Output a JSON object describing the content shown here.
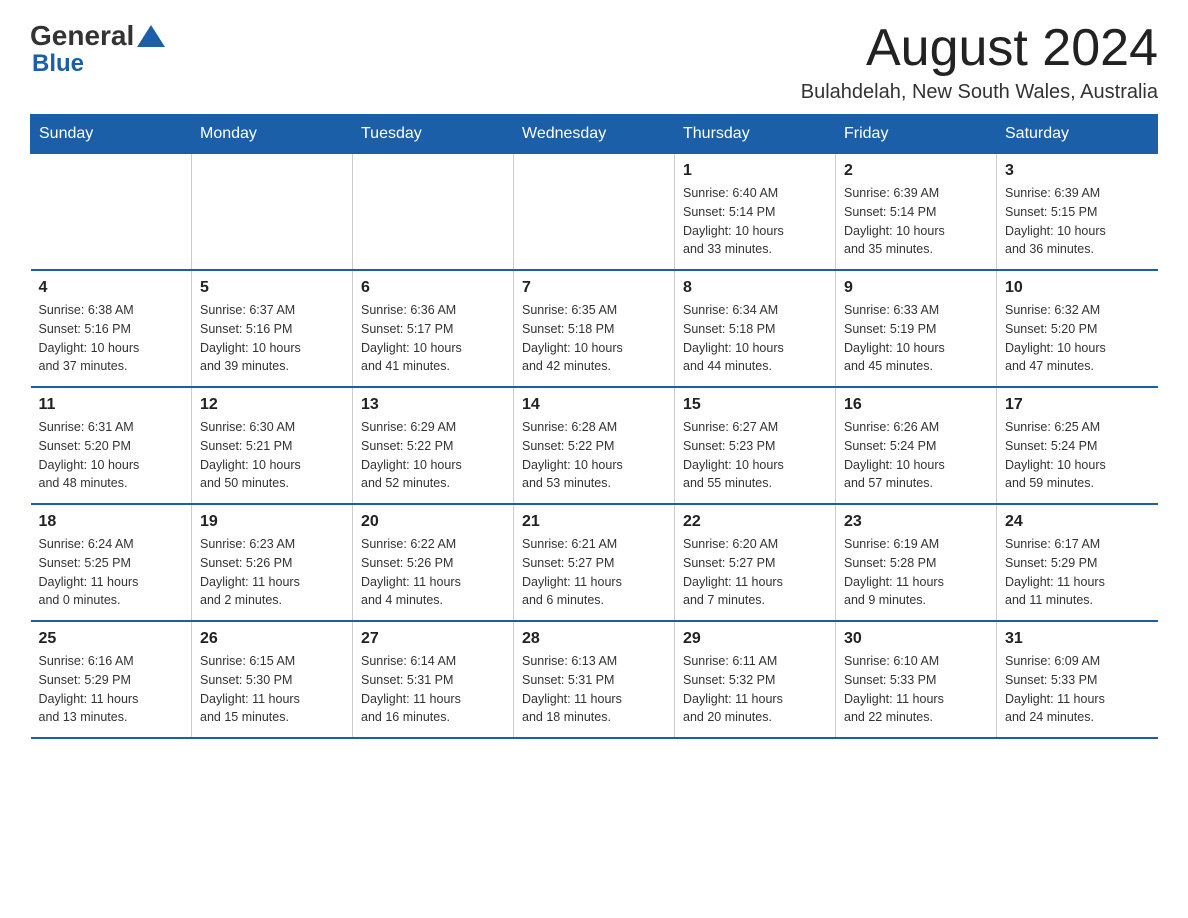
{
  "header": {
    "logo_general": "General",
    "logo_blue": "Blue",
    "month_title": "August 2024",
    "location": "Bulahdelah, New South Wales, Australia"
  },
  "calendar": {
    "days_of_week": [
      "Sunday",
      "Monday",
      "Tuesday",
      "Wednesday",
      "Thursday",
      "Friday",
      "Saturday"
    ],
    "weeks": [
      [
        {
          "day": "",
          "info": ""
        },
        {
          "day": "",
          "info": ""
        },
        {
          "day": "",
          "info": ""
        },
        {
          "day": "",
          "info": ""
        },
        {
          "day": "1",
          "info": "Sunrise: 6:40 AM\nSunset: 5:14 PM\nDaylight: 10 hours\nand 33 minutes."
        },
        {
          "day": "2",
          "info": "Sunrise: 6:39 AM\nSunset: 5:14 PM\nDaylight: 10 hours\nand 35 minutes."
        },
        {
          "day": "3",
          "info": "Sunrise: 6:39 AM\nSunset: 5:15 PM\nDaylight: 10 hours\nand 36 minutes."
        }
      ],
      [
        {
          "day": "4",
          "info": "Sunrise: 6:38 AM\nSunset: 5:16 PM\nDaylight: 10 hours\nand 37 minutes."
        },
        {
          "day": "5",
          "info": "Sunrise: 6:37 AM\nSunset: 5:16 PM\nDaylight: 10 hours\nand 39 minutes."
        },
        {
          "day": "6",
          "info": "Sunrise: 6:36 AM\nSunset: 5:17 PM\nDaylight: 10 hours\nand 41 minutes."
        },
        {
          "day": "7",
          "info": "Sunrise: 6:35 AM\nSunset: 5:18 PM\nDaylight: 10 hours\nand 42 minutes."
        },
        {
          "day": "8",
          "info": "Sunrise: 6:34 AM\nSunset: 5:18 PM\nDaylight: 10 hours\nand 44 minutes."
        },
        {
          "day": "9",
          "info": "Sunrise: 6:33 AM\nSunset: 5:19 PM\nDaylight: 10 hours\nand 45 minutes."
        },
        {
          "day": "10",
          "info": "Sunrise: 6:32 AM\nSunset: 5:20 PM\nDaylight: 10 hours\nand 47 minutes."
        }
      ],
      [
        {
          "day": "11",
          "info": "Sunrise: 6:31 AM\nSunset: 5:20 PM\nDaylight: 10 hours\nand 48 minutes."
        },
        {
          "day": "12",
          "info": "Sunrise: 6:30 AM\nSunset: 5:21 PM\nDaylight: 10 hours\nand 50 minutes."
        },
        {
          "day": "13",
          "info": "Sunrise: 6:29 AM\nSunset: 5:22 PM\nDaylight: 10 hours\nand 52 minutes."
        },
        {
          "day": "14",
          "info": "Sunrise: 6:28 AM\nSunset: 5:22 PM\nDaylight: 10 hours\nand 53 minutes."
        },
        {
          "day": "15",
          "info": "Sunrise: 6:27 AM\nSunset: 5:23 PM\nDaylight: 10 hours\nand 55 minutes."
        },
        {
          "day": "16",
          "info": "Sunrise: 6:26 AM\nSunset: 5:24 PM\nDaylight: 10 hours\nand 57 minutes."
        },
        {
          "day": "17",
          "info": "Sunrise: 6:25 AM\nSunset: 5:24 PM\nDaylight: 10 hours\nand 59 minutes."
        }
      ],
      [
        {
          "day": "18",
          "info": "Sunrise: 6:24 AM\nSunset: 5:25 PM\nDaylight: 11 hours\nand 0 minutes."
        },
        {
          "day": "19",
          "info": "Sunrise: 6:23 AM\nSunset: 5:26 PM\nDaylight: 11 hours\nand 2 minutes."
        },
        {
          "day": "20",
          "info": "Sunrise: 6:22 AM\nSunset: 5:26 PM\nDaylight: 11 hours\nand 4 minutes."
        },
        {
          "day": "21",
          "info": "Sunrise: 6:21 AM\nSunset: 5:27 PM\nDaylight: 11 hours\nand 6 minutes."
        },
        {
          "day": "22",
          "info": "Sunrise: 6:20 AM\nSunset: 5:27 PM\nDaylight: 11 hours\nand 7 minutes."
        },
        {
          "day": "23",
          "info": "Sunrise: 6:19 AM\nSunset: 5:28 PM\nDaylight: 11 hours\nand 9 minutes."
        },
        {
          "day": "24",
          "info": "Sunrise: 6:17 AM\nSunset: 5:29 PM\nDaylight: 11 hours\nand 11 minutes."
        }
      ],
      [
        {
          "day": "25",
          "info": "Sunrise: 6:16 AM\nSunset: 5:29 PM\nDaylight: 11 hours\nand 13 minutes."
        },
        {
          "day": "26",
          "info": "Sunrise: 6:15 AM\nSunset: 5:30 PM\nDaylight: 11 hours\nand 15 minutes."
        },
        {
          "day": "27",
          "info": "Sunrise: 6:14 AM\nSunset: 5:31 PM\nDaylight: 11 hours\nand 16 minutes."
        },
        {
          "day": "28",
          "info": "Sunrise: 6:13 AM\nSunset: 5:31 PM\nDaylight: 11 hours\nand 18 minutes."
        },
        {
          "day": "29",
          "info": "Sunrise: 6:11 AM\nSunset: 5:32 PM\nDaylight: 11 hours\nand 20 minutes."
        },
        {
          "day": "30",
          "info": "Sunrise: 6:10 AM\nSunset: 5:33 PM\nDaylight: 11 hours\nand 22 minutes."
        },
        {
          "day": "31",
          "info": "Sunrise: 6:09 AM\nSunset: 5:33 PM\nDaylight: 11 hours\nand 24 minutes."
        }
      ]
    ]
  }
}
